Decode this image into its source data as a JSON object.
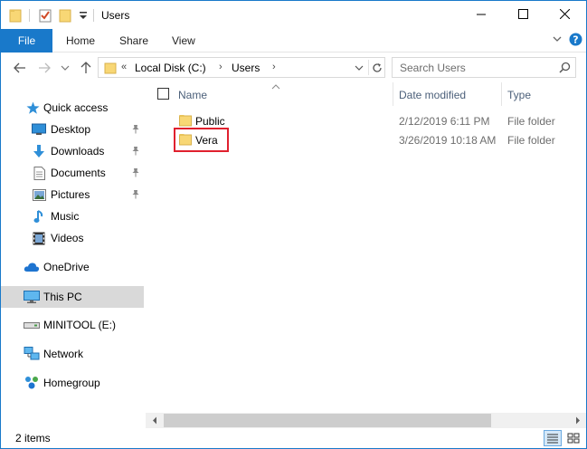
{
  "window": {
    "title": "Users",
    "controls": {
      "minimize": "minimize-icon",
      "maximize": "maximize-icon",
      "close": "close-icon"
    }
  },
  "ribbon": {
    "tabs": [
      "File",
      "Home",
      "Share",
      "View"
    ],
    "accent_color": "#1979ca"
  },
  "address": {
    "overflow": "«",
    "crumbs": [
      "Local Disk (C:)",
      "Users"
    ],
    "separator": "›"
  },
  "search": {
    "placeholder": "Search Users"
  },
  "nav_pane": {
    "quick_access": "Quick access",
    "items": [
      {
        "label": "Desktop",
        "icon": "desktop-icon",
        "pinned": true
      },
      {
        "label": "Downloads",
        "icon": "download-icon",
        "pinned": true
      },
      {
        "label": "Documents",
        "icon": "documents-icon",
        "pinned": true
      },
      {
        "label": "Pictures",
        "icon": "pictures-icon",
        "pinned": true
      },
      {
        "label": "Music",
        "icon": "music-icon",
        "pinned": false
      },
      {
        "label": "Videos",
        "icon": "videos-icon",
        "pinned": false
      }
    ],
    "onedrive": "OneDrive",
    "this_pc": "This PC",
    "drive": "MINITOOL (E:)",
    "network": "Network",
    "homegroup": "Homegroup"
  },
  "file_list": {
    "columns": {
      "name": "Name",
      "date": "Date modified",
      "type": "Type"
    },
    "rows": [
      {
        "name": "Public",
        "date": "2/12/2019 6:11 PM",
        "type": "File folder"
      },
      {
        "name": "Vera",
        "date": "3/26/2019 10:18 AM",
        "type": "File folder"
      }
    ],
    "highlight_color": "#e0202e"
  },
  "status": {
    "count": "2 items"
  }
}
